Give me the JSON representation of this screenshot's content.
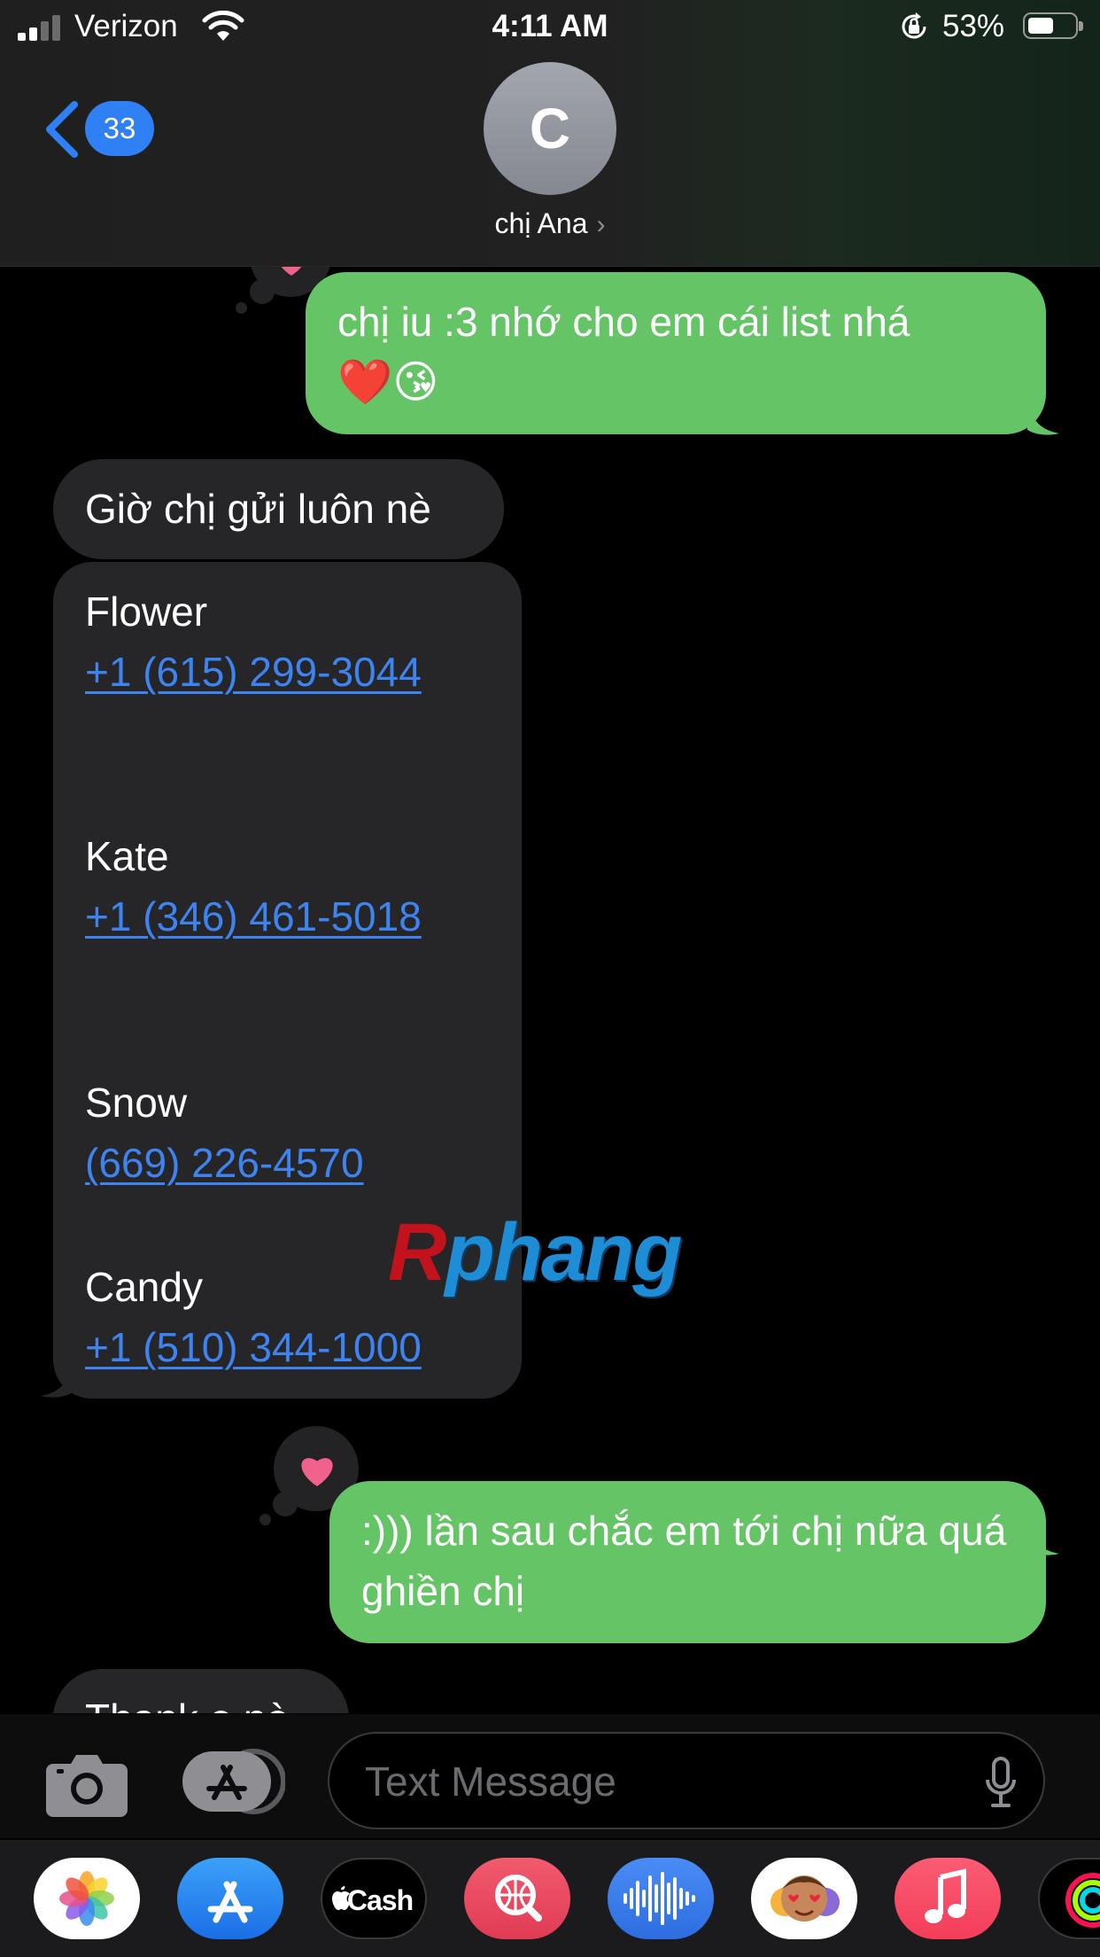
{
  "status_bar": {
    "carrier": "Verizon",
    "time": "4:11 AM",
    "battery": "53%",
    "battery_level": 0.53
  },
  "header": {
    "back_count": "33",
    "avatar_initial": "C",
    "contact_name": "chị Ana",
    "chevron": "›"
  },
  "messages": [
    {
      "direction": "sent",
      "text": "chị iu :3 nhớ cho em cái list nhá",
      "emoji": "❤️😘"
    },
    {
      "direction": "received",
      "text": "Giờ chị gửi luôn nè"
    },
    {
      "direction": "received",
      "contacts": [
        {
          "name": "Flower",
          "phone": "+1 (615) 299-3044"
        },
        {
          "name": "Kate",
          "phone": "+1 (346) 461-5018"
        },
        {
          "name": "Snow",
          "phone": "(669) 226-4570"
        },
        {
          "name": "Candy",
          "phone": "+1 (510) 344-1000"
        }
      ]
    },
    {
      "direction": "sent",
      "text": ":))) lần sau chắc em tới chị nữa quá ghiền chị",
      "tapback": "heart"
    },
    {
      "direction": "received",
      "text": "Thank e nè"
    }
  ],
  "watermark": {
    "first": "R",
    "rest": "phang"
  },
  "input": {
    "placeholder": "Text Message"
  },
  "app_drawer": {
    "items": [
      {
        "icon": "photos-icon"
      },
      {
        "icon": "app-store-icon"
      },
      {
        "icon": "apple-cash-icon",
        "label": "Cash"
      },
      {
        "icon": "web-search-icon"
      },
      {
        "icon": "audio-message-icon"
      },
      {
        "icon": "memoji-icon"
      },
      {
        "icon": "music-icon"
      },
      {
        "icon": "activity-icon"
      }
    ]
  },
  "colors": {
    "sent_bubble": "#65c466",
    "received_bubble": "#262628",
    "link": "#3e84f0",
    "accent": "#2f7ff5",
    "heart": "#f0628c"
  }
}
